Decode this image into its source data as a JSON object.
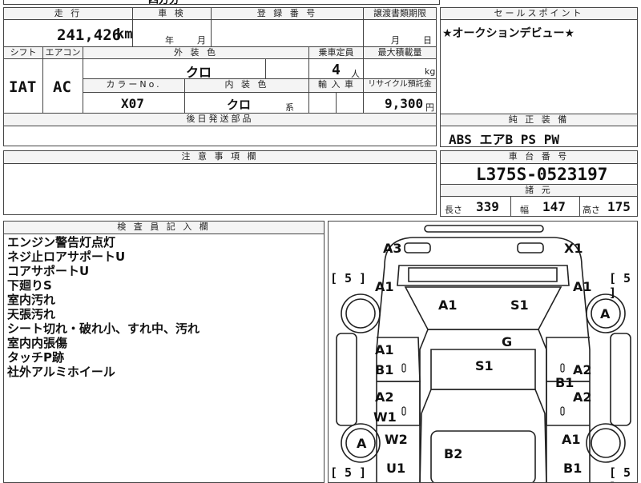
{
  "top_partial": "四方分",
  "mileage": {
    "header": "走 行",
    "value": "241,426",
    "unit": "km"
  },
  "inspection": {
    "header": "車 検",
    "year_unit": "年",
    "month_unit": "月"
  },
  "registration": {
    "header": "登 録 番 号"
  },
  "transfer": {
    "header": "譲渡書類期限",
    "month_unit": "月",
    "day_unit": "日"
  },
  "sales_point": {
    "header": "セールスポイント",
    "text": "★オークションデビュー★"
  },
  "shift": {
    "header": "シフト",
    "value": "IAT"
  },
  "aircon": {
    "header": "エアコン",
    "value": "AC"
  },
  "exterior_color": {
    "header": "外 装 色",
    "value": "クロ"
  },
  "capacity": {
    "header": "乗車定員",
    "value": "4",
    "unit": "人"
  },
  "max_load": {
    "header": "最大積載量",
    "unit": "kg"
  },
  "color_no": {
    "header": "カラーNo.",
    "value": "X07"
  },
  "interior_color": {
    "header": "内 装 色",
    "value": "クロ",
    "suffix": "系"
  },
  "import": {
    "header": "輸 入 車"
  },
  "recycle": {
    "header": "リサイクル預託金",
    "value": "9,300",
    "unit": "円"
  },
  "later_parts": {
    "header": "後日発送部品"
  },
  "genuine_equipment": {
    "header": "純 正 装 備",
    "value": "ABS エアB PS PW"
  },
  "notes": {
    "header": "注 意 事 項 欄"
  },
  "chassis": {
    "header": "車 台 番 号",
    "value": "L375S-0523197"
  },
  "specs": {
    "header": "諸 元",
    "length_label": "長さ",
    "length": "339",
    "width_label": "幅",
    "width": "147",
    "height_label": "高さ",
    "height": "175"
  },
  "inspector": {
    "header": "検 査 員 記 入 欄",
    "remarks": [
      "エンジン警告灯点灯",
      "ネジ止ロアサポートU",
      "コアサポートU",
      "下廻りS",
      "室内汚れ",
      "天張汚れ",
      "シート切れ・破れ小、すれ中、汚れ",
      "室内内張傷",
      "タッチP跡",
      "社外アルミホイール"
    ]
  },
  "diagram": {
    "tire_count": "[ 5 ]",
    "marks": {
      "front_left": "A3",
      "front_right": "X1",
      "fender_fl": "A1",
      "fender_fr": "A1",
      "hood_l": "A1",
      "hood_r": "S1",
      "roof": "G",
      "door_fl_1": "A1",
      "door_fl_2": "B1",
      "cabin": "S1",
      "door_fr": "A2",
      "pillar_r": "B1",
      "door_rl_1": "A2",
      "door_rl_2": "W1",
      "door_rr": "A2",
      "wheel_fl": "A",
      "wheel_rl": "A",
      "rear_l": "W2",
      "rear_r": "A1",
      "rear_bottom_l": "U1",
      "rear_center": "B2",
      "rear_bottom_r": "B1"
    }
  }
}
